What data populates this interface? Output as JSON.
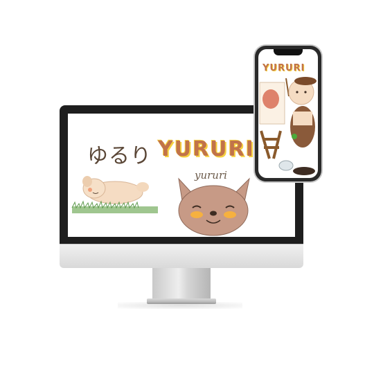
{
  "site": {
    "brand_jp": "ゆるり",
    "brand_en": "YURURI",
    "script_label": "yururi"
  },
  "phone": {
    "brand_en": "YURURI"
  },
  "colors": {
    "brand": "#c1734a",
    "brand_outline": "#f6d13f",
    "bezel": "#1e1e1e",
    "dog_fur": "#f5dcc3",
    "dog_face": "#c79a86",
    "grass": "#7fb36a"
  },
  "icons": {
    "monitor": "desktop-monitor-frame",
    "phone": "smartphone-frame",
    "sleeping_dog": "sleeping-dog-illustration",
    "dog_face": "dog-face-illustration",
    "painting_dog": "painting-dog-illustration"
  }
}
